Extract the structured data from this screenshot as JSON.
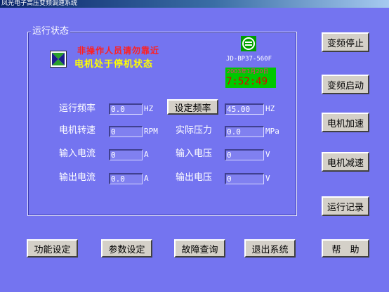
{
  "window": {
    "title": "凤光电子高压变频调速系统"
  },
  "status_panel": {
    "title": "运行状态",
    "warning_text": "非操作人员请勿靠近",
    "motor_state": "电机处于停机状态",
    "model": "JD-BP37-560F",
    "date": "2003年1月20日",
    "time": "7:52:49"
  },
  "readings": {
    "run_freq": {
      "label": "运行频率",
      "value": "0.0",
      "unit": "HZ"
    },
    "set_freq_button": "设定频率",
    "set_freq": {
      "value": "45.00",
      "unit": "HZ"
    },
    "motor_speed": {
      "label": "电机转速",
      "value": "0",
      "unit": "RPM"
    },
    "actual_pressure": {
      "label": "实际压力",
      "value": "0.0",
      "unit": "MPa"
    },
    "input_current": {
      "label": "输入电流",
      "value": "0",
      "unit": "A"
    },
    "input_voltage": {
      "label": "输入电压",
      "value": "0",
      "unit": "V"
    },
    "output_current": {
      "label": "输出电流",
      "value": "0.0",
      "unit": "A"
    },
    "output_voltage": {
      "label": "输出电压",
      "value": "0",
      "unit": "V"
    }
  },
  "side_buttons": {
    "stop": "变频停止",
    "start": "变频启动",
    "accelerate": "电机加速",
    "decelerate": "电机减速",
    "log": "运行记录"
  },
  "bottom_buttons": {
    "function_settings": "功能设定",
    "parameter_settings": "参数设定",
    "fault_query": "故障查询",
    "exit": "退出系统",
    "help": "帮　助"
  },
  "colors": {
    "background": "#7474f0",
    "warning": "#ff2020",
    "state": "#ffff00",
    "clock_bg": "#00c800",
    "clock_text": "#e00000"
  },
  "icons": {
    "stop_icon": "stop-icon",
    "logo": "logo-icon"
  }
}
